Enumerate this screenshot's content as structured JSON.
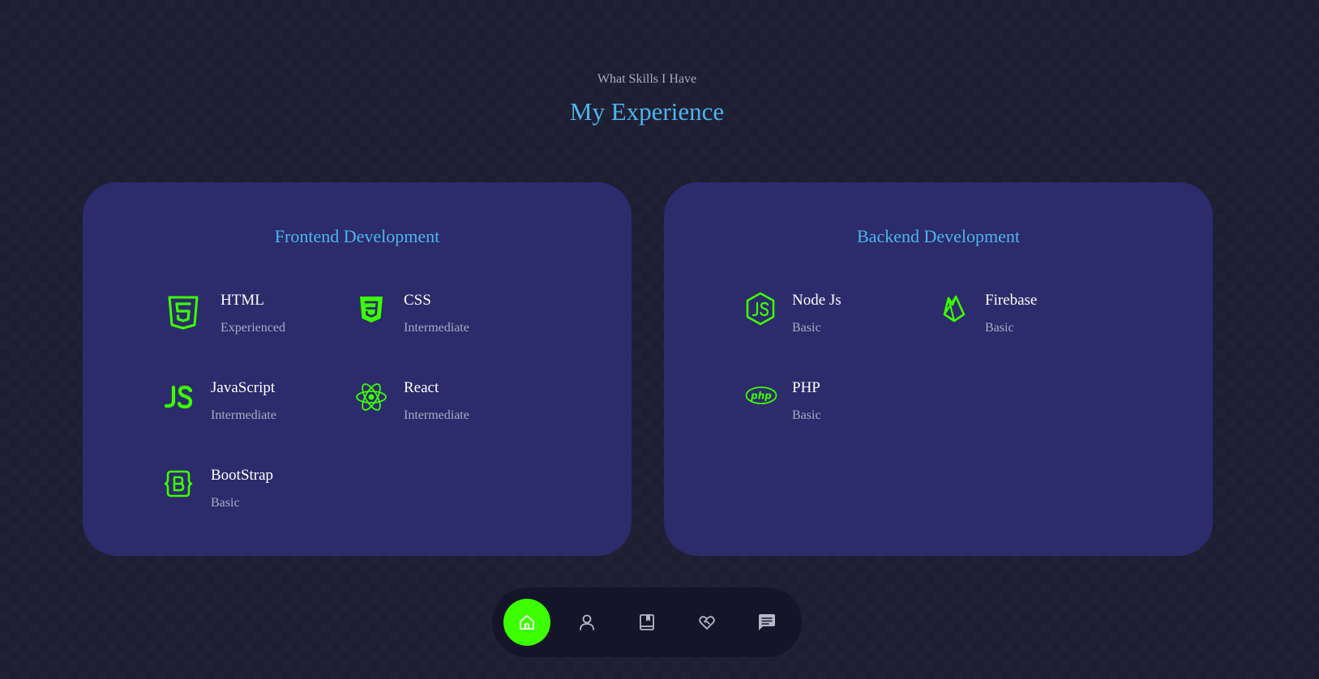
{
  "header": {
    "subtitle": "What Skills I Have",
    "title": "My Experience"
  },
  "colors": {
    "accent_green": "#3cff00",
    "title_blue": "#4db5ee",
    "card_bg": "#2c2b6b",
    "page_bg": "#1e1e33",
    "dock_bg": "#15152a"
  },
  "frontend": {
    "title": "Frontend Development",
    "skills": [
      {
        "name": "HTML",
        "level": "Experienced",
        "icon": "html5-icon"
      },
      {
        "name": "CSS",
        "level": "Intermediate",
        "icon": "css3-icon"
      },
      {
        "name": "JavaScript",
        "level": "Intermediate",
        "icon": "javascript-icon"
      },
      {
        "name": "React",
        "level": "Intermediate",
        "icon": "react-icon"
      },
      {
        "name": "BootStrap",
        "level": "Basic",
        "icon": "bootstrap-icon"
      }
    ]
  },
  "backend": {
    "title": "Backend Development",
    "skills": [
      {
        "name": "Node Js",
        "level": "Basic",
        "icon": "nodejs-icon"
      },
      {
        "name": "Firebase",
        "level": "Basic",
        "icon": "firebase-icon"
      },
      {
        "name": "PHP",
        "level": "Basic",
        "icon": "php-icon"
      }
    ]
  },
  "nav": {
    "items": [
      {
        "icon": "home-icon",
        "active": true
      },
      {
        "icon": "user-icon",
        "active": false
      },
      {
        "icon": "book-icon",
        "active": false
      },
      {
        "icon": "heart-handshake-icon",
        "active": false
      },
      {
        "icon": "chat-icon",
        "active": false
      }
    ]
  }
}
